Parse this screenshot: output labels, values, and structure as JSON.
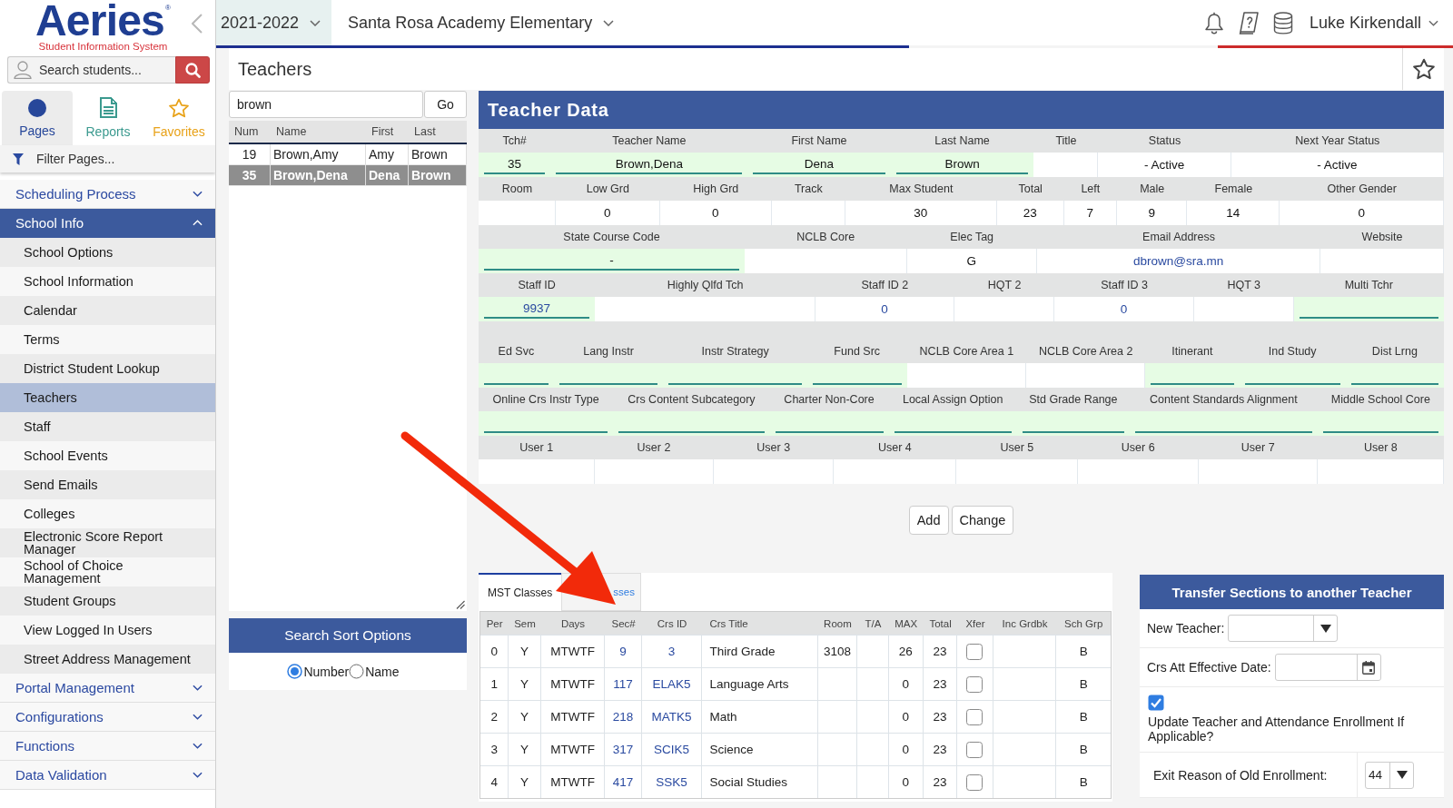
{
  "sidebar": {
    "logo": {
      "name": "Aeries",
      "mark": "®",
      "tagline": "Student Information System"
    },
    "search": {
      "placeholder": "Search students..."
    },
    "tabs": [
      {
        "label": "Pages",
        "kind": "dot",
        "selected": true,
        "color": "#27479a"
      },
      {
        "label": "Reports",
        "kind": "document",
        "selected": false,
        "color": "#3b9a8f"
      },
      {
        "label": "Favorites",
        "kind": "star",
        "selected": false,
        "color": "#e8a219"
      }
    ],
    "filter": {
      "placeholder": "Filter Pages..."
    },
    "nav": [
      {
        "label": "Scheduling Process",
        "expanded": false
      },
      {
        "label": "School Info",
        "expanded": true,
        "children": [
          {
            "label": "School Options",
            "selected": false
          },
          {
            "label": "School Information",
            "selected": false
          },
          {
            "label": "Calendar",
            "selected": false
          },
          {
            "label": "Terms",
            "selected": false
          },
          {
            "label": "District Student Lookup",
            "selected": false
          },
          {
            "label": "Teachers",
            "selected": true
          },
          {
            "label": "Staff",
            "selected": false
          },
          {
            "label": "School Events",
            "selected": false
          },
          {
            "label": "Send Emails",
            "selected": false
          },
          {
            "label": "Colleges",
            "selected": false
          },
          {
            "label": "Electronic Score Report Manager",
            "selected": false
          },
          {
            "label": "School of Choice Management",
            "selected": false
          },
          {
            "label": "Student Groups",
            "selected": false
          },
          {
            "label": "View Logged In Users",
            "selected": false
          },
          {
            "label": "Street Address Management",
            "selected": false
          }
        ]
      },
      {
        "label": "Portal Management",
        "expanded": false
      },
      {
        "label": "Configurations",
        "expanded": false
      },
      {
        "label": "Functions",
        "expanded": false
      },
      {
        "label": "Data Validation",
        "expanded": false
      }
    ]
  },
  "header": {
    "year": "2021-2022",
    "school": "Santa Rosa Academy Elementary",
    "user": "Luke Kirkendall"
  },
  "page": {
    "title": "Teachers"
  },
  "teacher_search": {
    "query": "brown",
    "button": "Go",
    "columns": [
      "Num",
      "Name",
      "First",
      "Last"
    ],
    "rows": [
      {
        "cells": [
          "19",
          "Brown,Amy",
          "Amy",
          "Brown"
        ],
        "selected": false
      },
      {
        "cells": [
          "35",
          "Brown,Dena",
          "Dena",
          "Brown"
        ],
        "selected": true
      }
    ]
  },
  "sort_options": {
    "title": "Search Sort Options",
    "options": [
      {
        "label": "Number",
        "selected": true
      },
      {
        "label": "Name",
        "selected": false
      }
    ]
  },
  "teacher_data": {
    "title": "Teacher Data",
    "sections": [
      {
        "fields": [
          {
            "label": "Tch#",
            "value": "35",
            "kind": "input"
          },
          {
            "label": "Teacher Name",
            "value": "Brown,Dena",
            "kind": "input"
          },
          {
            "label": "First Name",
            "value": "Dena",
            "kind": "input"
          },
          {
            "label": "Last Name",
            "value": "Brown",
            "kind": "input"
          },
          {
            "label": "Title",
            "kind": "cell"
          },
          {
            "label": "Status",
            "value": "- Active",
            "kind": "cell"
          },
          {
            "label": "Next Year Status",
            "value": "- Active",
            "kind": "cell"
          }
        ]
      },
      {
        "fields": [
          {
            "label": "Room",
            "kind": "cell"
          },
          {
            "label": "Low Grd",
            "value": "0",
            "kind": "cell"
          },
          {
            "label": "High Grd",
            "value": "0",
            "kind": "cell"
          },
          {
            "label": "Track",
            "kind": "cell"
          },
          {
            "label": "Max Student",
            "value": "30",
            "kind": "cell"
          },
          {
            "label": "Total",
            "value": "23",
            "kind": "cell"
          },
          {
            "label": "Left",
            "value": "7",
            "kind": "cell"
          },
          {
            "label": "Male",
            "value": "9",
            "kind": "cell"
          },
          {
            "label": "Female",
            "value": "14",
            "kind": "cell"
          },
          {
            "label": "Other Gender",
            "value": "0",
            "kind": "cell"
          }
        ]
      },
      {
        "fields": [
          {
            "label": "State Course Code",
            "value": "-",
            "kind": "input"
          },
          {
            "label": "NCLB Core",
            "kind": "cell"
          },
          {
            "label": "Elec Tag",
            "value": "G",
            "kind": "cell"
          },
          {
            "label": "Email Address",
            "value": "dbrown@sra.mn",
            "kind": "link"
          },
          {
            "label": "Website",
            "kind": "cell"
          }
        ]
      },
      {
        "fields": [
          {
            "label": "Staff ID",
            "value": "9937",
            "kind": "linkfield"
          },
          {
            "label": "Highly Qlfd Tch",
            "kind": "cell"
          },
          {
            "label": "Staff ID 2",
            "value": "0",
            "kind": "link"
          },
          {
            "label": "HQT 2",
            "kind": "cell"
          },
          {
            "label": "Staff ID 3",
            "value": "0",
            "kind": "link"
          },
          {
            "label": "HQT 3",
            "kind": "cell"
          },
          {
            "label": "Multi Tchr",
            "kind": "input"
          }
        ]
      },
      {
        "fields": [
          {
            "label": "Ed Svc",
            "kind": "input"
          },
          {
            "label": "Lang Instr",
            "kind": "input"
          },
          {
            "label": "Instr Strategy",
            "kind": "input"
          },
          {
            "label": "Fund Src",
            "kind": "input"
          },
          {
            "label": "NCLB Core Area 1",
            "kind": "cell"
          },
          {
            "label": "NCLB Core Area 2",
            "kind": "cell"
          },
          {
            "label": "Itinerant",
            "kind": "input"
          },
          {
            "label": "Ind Study",
            "kind": "input"
          },
          {
            "label": "Dist Lrng",
            "kind": "input"
          }
        ]
      },
      {
        "fields": [
          {
            "label": "Online Crs Instr Type",
            "kind": "input"
          },
          {
            "label": "Crs Content Subcategory",
            "kind": "input"
          },
          {
            "label": "Charter Non-Core",
            "kind": "input"
          },
          {
            "label": "Local Assign Option",
            "kind": "input"
          },
          {
            "label": "Std Grade Range",
            "kind": "input"
          },
          {
            "label": "Content Standards Alignment",
            "kind": "input"
          },
          {
            "label": "Middle School Core",
            "kind": "input"
          }
        ]
      },
      {
        "fields": [
          {
            "label": "User 1",
            "kind": "cell"
          },
          {
            "label": "User 2",
            "kind": "cell"
          },
          {
            "label": "User 3",
            "kind": "cell"
          },
          {
            "label": "User 4",
            "kind": "cell"
          },
          {
            "label": "User 5",
            "kind": "cell"
          },
          {
            "label": "User 6",
            "kind": "cell"
          },
          {
            "label": "User 7",
            "kind": "cell"
          },
          {
            "label": "User 8",
            "kind": "cell"
          }
        ]
      }
    ]
  },
  "actions": [
    "Add",
    "Change"
  ],
  "mst": {
    "tabs": [
      {
        "label": "MST Classes",
        "selected": true
      },
      {
        "label": "sses",
        "selected": false
      }
    ],
    "columns": [
      {
        "label": "Per",
        "kind": "text"
      },
      {
        "label": "Sem",
        "kind": "text"
      },
      {
        "label": "Days",
        "kind": "text"
      },
      {
        "label": "Sec#",
        "kind": "link"
      },
      {
        "label": "Crs ID",
        "kind": "link"
      },
      {
        "label": "Crs Title",
        "kind": "title"
      },
      {
        "label": "Room",
        "kind": "text"
      },
      {
        "label": "T/A",
        "kind": "text"
      },
      {
        "label": "MAX",
        "kind": "text"
      },
      {
        "label": "Total",
        "kind": "text"
      },
      {
        "label": "Xfer",
        "kind": "check"
      },
      {
        "label": "Inc Grdbk",
        "kind": "text"
      },
      {
        "label": "Sch Grp",
        "kind": "text"
      }
    ],
    "rows": [
      {
        "per": "0",
        "sem": "Y",
        "days": "MTWTF",
        "sec": "9",
        "crs_id": "3",
        "crs_title": "Third Grade",
        "room": "3108",
        "max": "26",
        "total": "23",
        "xfer": false,
        "sch_grp": "B"
      },
      {
        "per": "1",
        "sem": "Y",
        "days": "MTWTF",
        "sec": "117",
        "crs_id": "ELAK5",
        "crs_title": "Language Arts",
        "max": "0",
        "total": "23",
        "xfer": false,
        "sch_grp": "B"
      },
      {
        "per": "2",
        "sem": "Y",
        "days": "MTWTF",
        "sec": "218",
        "crs_id": "MATK5",
        "crs_title": "Math",
        "max": "0",
        "total": "23",
        "xfer": false,
        "sch_grp": "B"
      },
      {
        "per": "3",
        "sem": "Y",
        "days": "MTWTF",
        "sec": "317",
        "crs_id": "SCIK5",
        "crs_title": "Science",
        "max": "0",
        "total": "23",
        "xfer": false,
        "sch_grp": "B"
      },
      {
        "per": "4",
        "sem": "Y",
        "days": "MTWTF",
        "sec": "417",
        "crs_id": "SSK5",
        "crs_title": "Social Studies",
        "max": "0",
        "total": "23",
        "xfer": false,
        "sch_grp": "B"
      }
    ]
  },
  "transfer": {
    "title": "Transfer Sections to another Teacher",
    "fields": [
      {
        "kind": "select",
        "label": "New Teacher:"
      },
      {
        "kind": "date",
        "label": "Crs Att Effective Date:"
      },
      {
        "kind": "checkbox",
        "label": "Update Teacher and Attendance Enrollment If Applicable?",
        "checked": true
      },
      {
        "kind": "pair",
        "label": "Exit Reason of Old Enrollment:",
        "value": "44"
      }
    ]
  }
}
